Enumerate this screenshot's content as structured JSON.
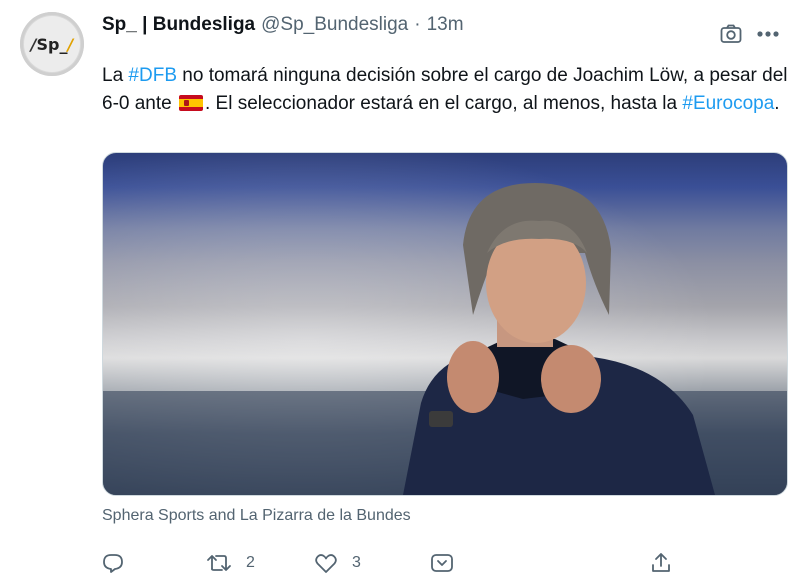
{
  "author": {
    "display_name": "Sp_ | Bundesliga",
    "handle": "@Sp_Bundesliga",
    "separator": "·",
    "time": "13m",
    "avatar_text": "Sp_"
  },
  "tweet": {
    "text_1": "La ",
    "hashtag_1": "#DFB",
    "text_2": " no tomará ninguna decisión sobre el cargo de Joachim Löw, a pesar del 6-0 ante ",
    "text_3": ". El seleccionador estará en el cargo, al menos, hasta la ",
    "hashtag_2": "#Eurocopa",
    "text_4": "."
  },
  "media": {
    "credit": "Sphera Sports and La Pizarra de la Bundes"
  },
  "actions": {
    "retweet_count": "2",
    "like_count": "3"
  },
  "icons": [
    "camera-icon",
    "more-icon",
    "reply-icon",
    "retweet-icon",
    "like-icon",
    "share-icon",
    "flag-spain-icon"
  ],
  "colors": {
    "hashtag": "#1d9bf0",
    "secondary_text": "#536471"
  }
}
